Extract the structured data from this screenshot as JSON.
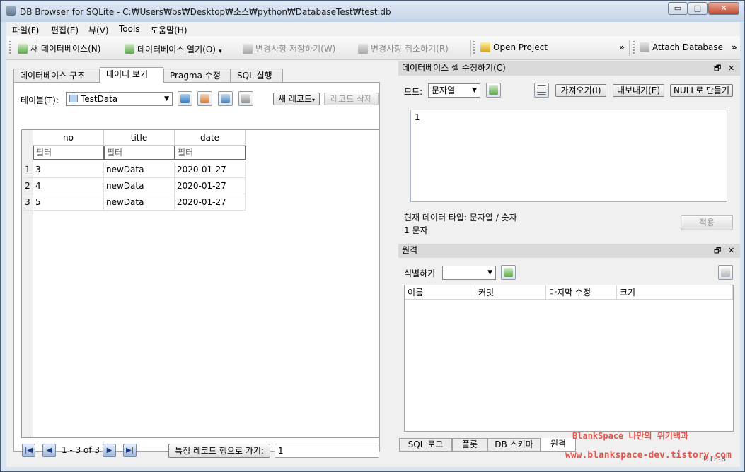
{
  "window": {
    "title": "DB Browser for SQLite - C:₩Users₩bs₩Desktop₩소스₩python₩DatabaseTest₩test.db",
    "minimize": "▭",
    "maximize": "□",
    "close": "✕"
  },
  "menu": [
    "파일(F)",
    "편집(E)",
    "뷰(V)",
    "Tools",
    "도움말(H)"
  ],
  "toolbar": {
    "new_db": "새 데이터베이스(N)",
    "open_db": "데이터베이스 열기(O)",
    "write_changes": "변경사항 저장하기(W)",
    "revert_changes": "변경사항 취소하기(R)",
    "open_project": "Open Project",
    "overflow1": "»",
    "attach_db": "Attach Database",
    "overflow2": "»"
  },
  "tabs": [
    "데이터베이스 구조",
    "데이터 보기",
    "Pragma 수정",
    "SQL 실행"
  ],
  "browse": {
    "table_label": "테이블(T):",
    "table_value": "TestData",
    "new_record": "새 레코드",
    "delete_record": "레코드 삭제",
    "columns": [
      "no",
      "title",
      "date"
    ],
    "filter_placeholder": "필터",
    "rows": [
      {
        "n": "1",
        "cells": [
          "3",
          "newData",
          "2020-01-27"
        ]
      },
      {
        "n": "2",
        "cells": [
          "4",
          "newData",
          "2020-01-27"
        ]
      },
      {
        "n": "3",
        "cells": [
          "5",
          "newData",
          "2020-01-27"
        ]
      }
    ],
    "record_range": "1 - 3 of 3",
    "goto_label": "특정 레코드 행으로 가기:",
    "goto_value": "1"
  },
  "edit_cell": {
    "title": "데이터베이스 셀 수정하기(C)",
    "mode_label": "모드:",
    "mode_value": "문자열",
    "import_btn": "가져오기(I)",
    "export_btn": "내보내기(E)",
    "null_btn": "NULL로 만들기",
    "content": "1",
    "type_info": "현재 데이터 타입: 문자열 / 숫자",
    "size_info": "1 문자",
    "apply_btn": "적용"
  },
  "remote": {
    "title": "원격",
    "identity_label": "식별하기",
    "identity_value": "",
    "columns": [
      "이름",
      "커밋",
      "마지막 수정",
      "크기"
    ]
  },
  "bottom_tabs": [
    "SQL 로그",
    "플롯",
    "DB 스키마",
    "원격"
  ],
  "status": {
    "encoding": "UTF-8"
  },
  "watermark": {
    "line1": "BlankSpace 나만의 위키백과",
    "line2": "www.blankspace-dev.tistory.com"
  },
  "colors": {
    "accent": "#1a3a8a",
    "watermark": "#e5534b"
  }
}
